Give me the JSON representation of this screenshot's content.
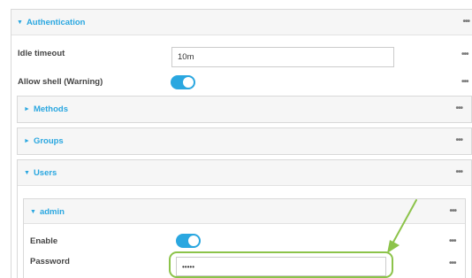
{
  "authentication": {
    "title": "Authentication",
    "idle_timeout": {
      "label": "Idle timeout",
      "value": "10m"
    },
    "allow_shell": {
      "label": "Allow shell (Warning)",
      "enabled": true
    }
  },
  "sections": {
    "methods": {
      "title": "Methods",
      "expanded": false
    },
    "groups": {
      "title": "Groups",
      "expanded": false
    },
    "users": {
      "title": "Users",
      "expanded": true
    }
  },
  "admin": {
    "title": "admin",
    "enable": {
      "label": "Enable",
      "enabled": true
    },
    "password": {
      "label": "Password",
      "value": "•••••"
    }
  },
  "icons": {
    "collapse": "triangle-down-icon",
    "expand": "triangle-right-icon",
    "menu": "ellipsis-icon"
  },
  "colors": {
    "accent": "#2aa7e0",
    "annotation": "#8cc34a"
  },
  "glyphs": {
    "down": "▼",
    "right": "►",
    "dots": "•••"
  }
}
